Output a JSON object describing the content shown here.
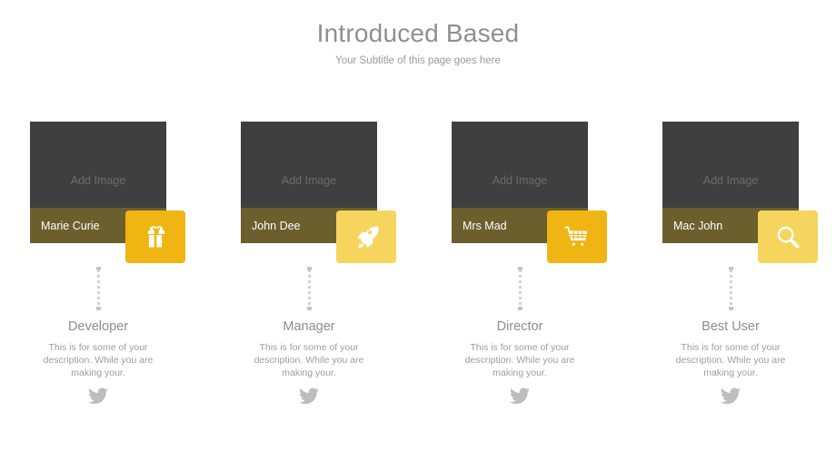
{
  "header": {
    "title": "Introduced Based",
    "subtitle": "Your Subtitle of this page goes here"
  },
  "colors": {
    "photo_bg": "#3f3f3f",
    "photo_label": "#6b6b6b",
    "name_bar": "#6b5f2d",
    "badge_amber": "#f0b513",
    "badge_light_yellow": "#f5d55e",
    "title_gray": "#8f8f8f",
    "body_gray": "#9d9d9d",
    "connector_gray": "#d2d2d2",
    "social_gray": "#bdbdbd",
    "page_bg": "#ffffff"
  },
  "cards": [
    {
      "photo_placeholder": "Add Image",
      "name": "Marie Curie",
      "badge_icon": "gift-icon",
      "badge_color": "#f0b513",
      "role": "Developer",
      "description": "This is for some of your description. While you are making your.",
      "social_icon": "twitter-icon"
    },
    {
      "photo_placeholder": "Add Image",
      "name": "John Dee",
      "badge_icon": "rocket-icon",
      "badge_color": "#f5d55e",
      "role": "Manager",
      "description": "This is for some of your description. While you are making your.",
      "social_icon": "twitter-icon"
    },
    {
      "photo_placeholder": "Add Image",
      "name": "Mrs Mad",
      "badge_icon": "shopping-cart-icon",
      "badge_color": "#f0b513",
      "role": "Director",
      "description": "This is for some of your description. While you are making your.",
      "social_icon": "twitter-icon"
    },
    {
      "photo_placeholder": "Add Image",
      "name": "Mac John",
      "badge_icon": "search-icon",
      "badge_color": "#f5d55e",
      "role": "Best User",
      "description": "This is for some of your description. While you are making your.",
      "social_icon": "twitter-icon"
    }
  ]
}
